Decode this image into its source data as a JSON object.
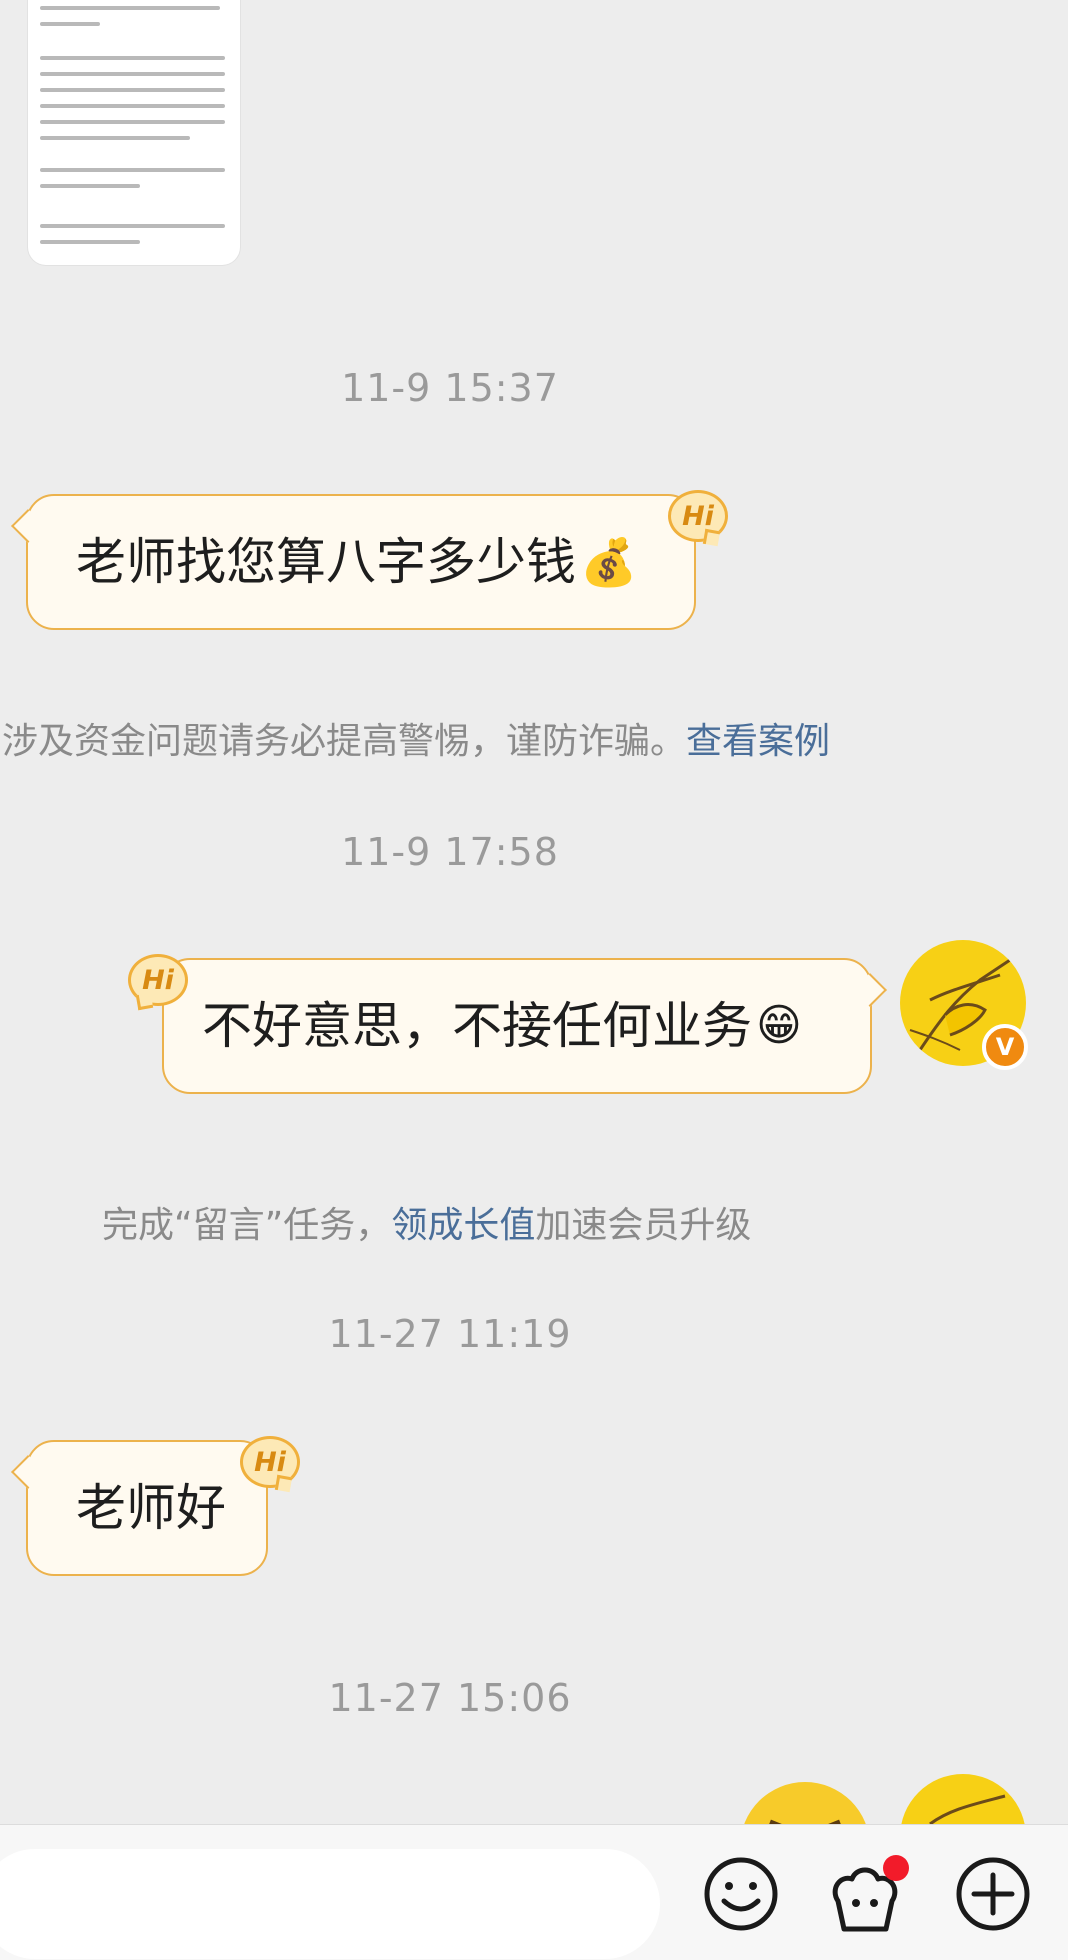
{
  "messages": [
    {
      "type": "time",
      "text": "11-9 15:37"
    },
    {
      "type": "received",
      "text": "老师找您算八字多少钱",
      "emoji": "💰"
    },
    {
      "type": "notice",
      "text": "涉及资金问题请务必提高警惕，谨防诈骗。",
      "link": "查看案例"
    },
    {
      "type": "time",
      "text": "11-9 17:58"
    },
    {
      "type": "sent",
      "text": "不好意思，不接任何业务",
      "emoji": "😁"
    },
    {
      "type": "notice",
      "prefix": "完成“留言”任务，",
      "link": "领成长值",
      "suffix": "加速会员升级"
    },
    {
      "type": "time",
      "text": "11-27 11:19"
    },
    {
      "type": "received",
      "text": "老师好"
    },
    {
      "type": "time",
      "text": "11-27 15:06"
    }
  ],
  "hi_badge": "Hi",
  "verified_badge": "V",
  "bottom_bar": {
    "icons": [
      "emoji-face-icon",
      "super-topic-icon",
      "plus-icon"
    ],
    "has_notification_dot": true
  },
  "colors": {
    "background": "#ededed",
    "bubble_fill": "#fffaf0",
    "bubble_border": "#ecb24c",
    "link": "#4a6e99",
    "avatar": "#f7d015",
    "badge": "#f08a10",
    "notification": "#f21b2a"
  }
}
